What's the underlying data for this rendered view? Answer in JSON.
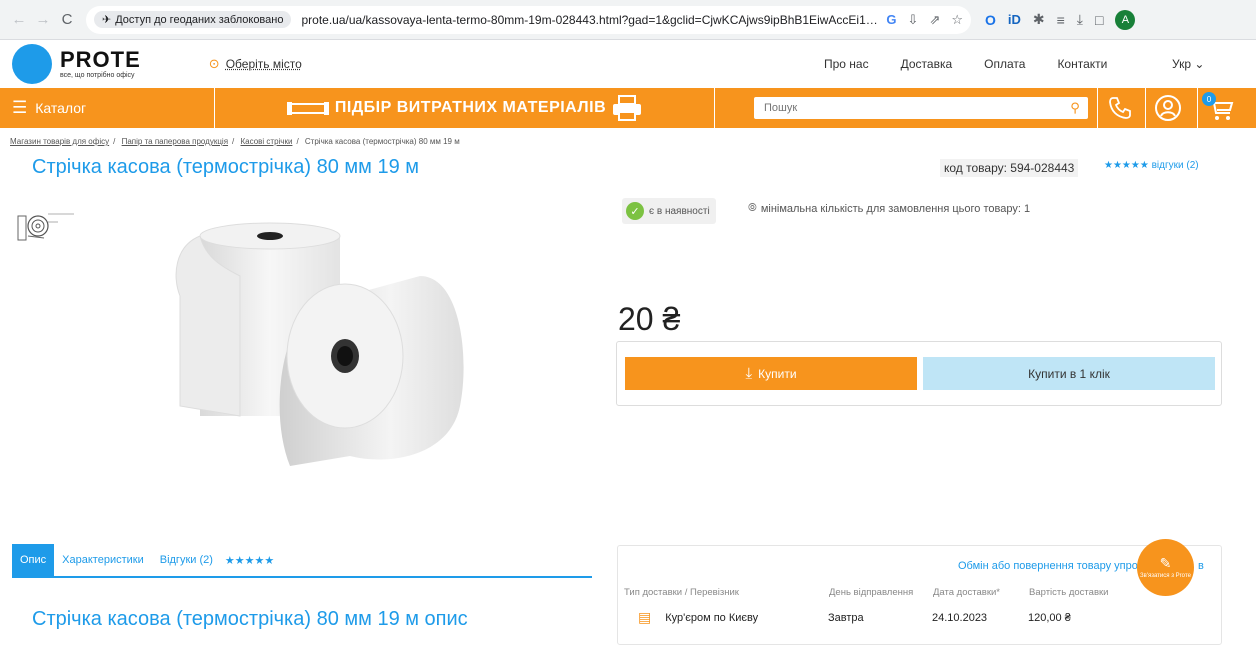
{
  "browser": {
    "geo_chip": "Доступ до геоданих заблоковано",
    "url": "prote.ua/ua/kassovaya-lenta-termo-80mm-19m-028443.html?gad=1&gclid=CjwKCAjws9ipBhB1EiwAccEi1MXG-Na5ZAzRHvw...",
    "profile_initial": "A"
  },
  "header": {
    "logo_name": "PROTE",
    "logo_tagline": "все, що потрібно офісу",
    "city": "Оберіть місто",
    "nav": [
      "Про нас",
      "Доставка",
      "Оплата",
      "Контакти"
    ],
    "lang": "Укр"
  },
  "orange_bar": {
    "catalog": "Каталог",
    "promo": "ПІДБІР ВИТРАТНИХ МАТЕРІАЛІВ",
    "search_placeholder": "Пошук",
    "cart_count": "0"
  },
  "breadcrumb": {
    "items": [
      "Магазин товарів для офісу",
      "Папір та паперова продукція",
      "Касові стрічки"
    ],
    "current": "Стрічка касова (термострічка) 80 мм 19 м"
  },
  "product": {
    "title": "Стрічка касова (термострічка) 80 мм 19 м",
    "sku": "код товару: 594-028443",
    "stars": "★★★★★",
    "reviews_link": "відгуки (2)",
    "stock": "є в наявності",
    "min_qty": "мінімальна кількість для замовлення цього товару: 1",
    "price": "20 ₴",
    "buy_label": "Купити",
    "one_click_label": "Купити в 1 клік"
  },
  "tabs": {
    "items": [
      "Опис",
      "Характеристики",
      "Відгуки (2)"
    ],
    "stars": "★★★★★"
  },
  "description": {
    "title": "Стрічка касова (термострічка) 80 мм 19 м опис"
  },
  "delivery": {
    "exchange_link": "Обмін або повернення товару упро",
    "exchange_end": "в",
    "headers": [
      "Тип доставки / Перевізник",
      "День відправлення",
      "Дата доставки*",
      "Вартість доставки"
    ],
    "row": {
      "carrier": "Кур'єром по Києву",
      "ship_day": "Завтра",
      "date": "24.10.2023",
      "cost": "120,00 ₴"
    }
  },
  "chat": {
    "label": "Зв'язатися з Proте"
  },
  "colors": {
    "brand_orange": "#f7941d",
    "brand_blue": "#1e9be9",
    "stock_green": "#7cc242"
  }
}
